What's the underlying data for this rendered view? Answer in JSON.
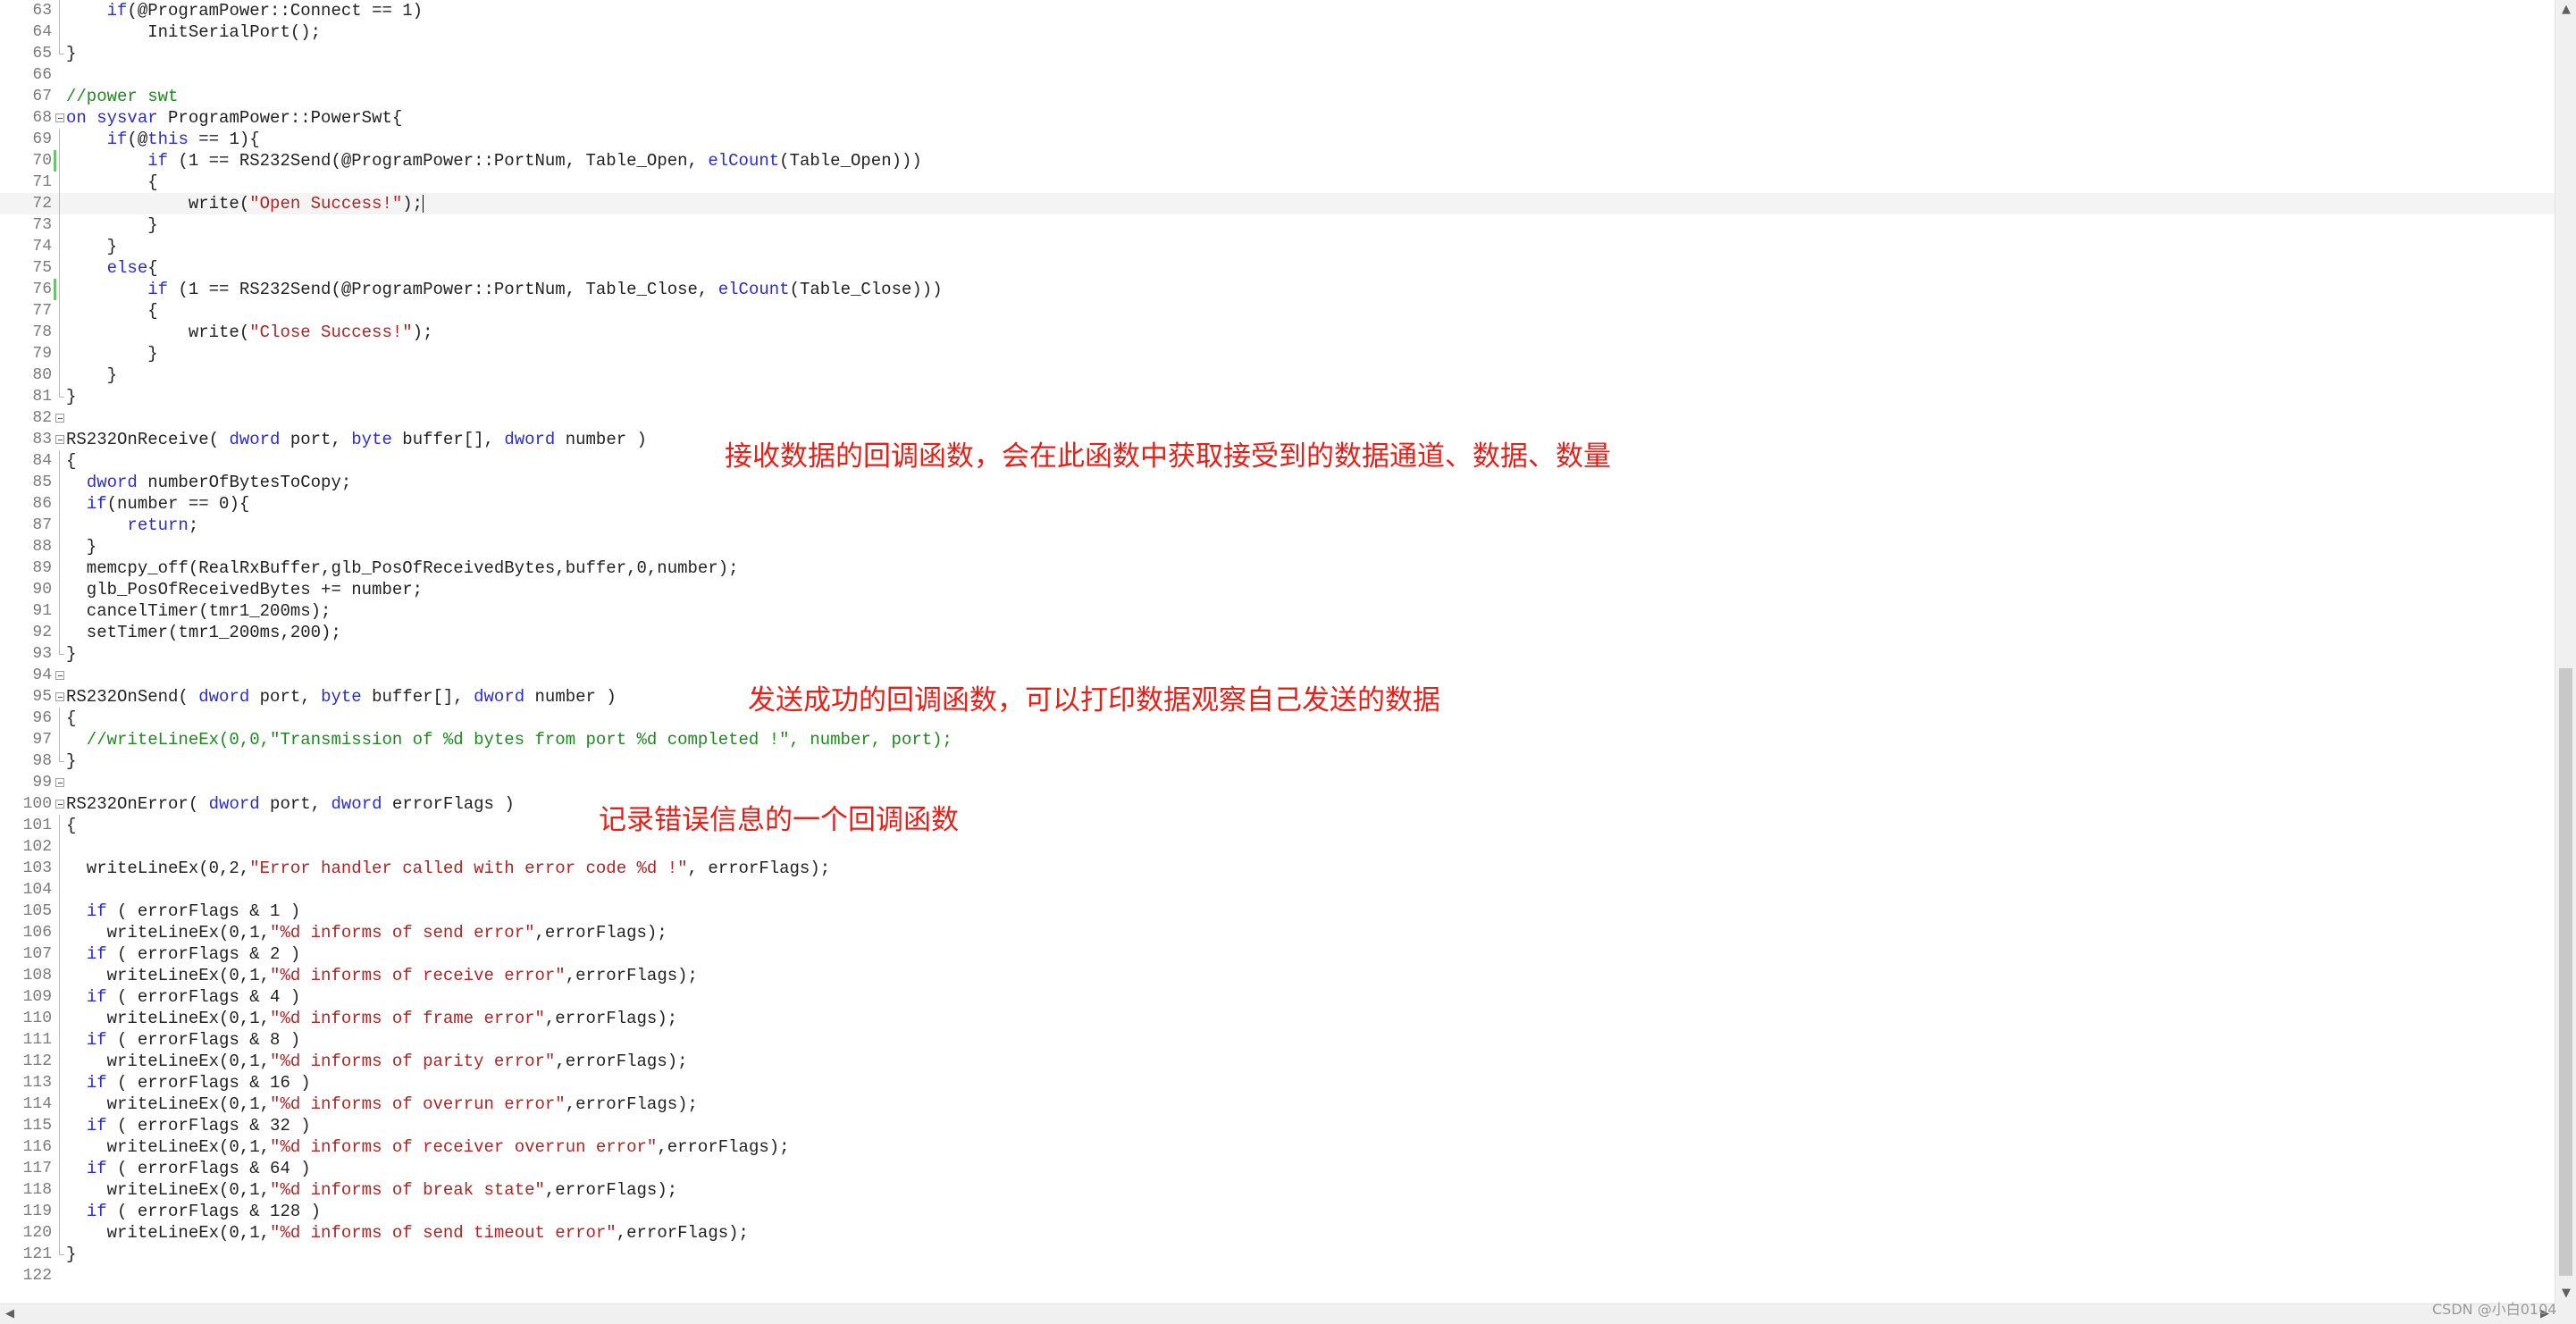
{
  "editor": {
    "lines": [
      {
        "n": "63",
        "fold": "line",
        "changed": false,
        "current": false,
        "tokens": [
          {
            "t": "    "
          },
          {
            "t": "if",
            "c": "kw"
          },
          {
            "t": "(@ProgramPower::Connect == 1)"
          }
        ]
      },
      {
        "n": "64",
        "fold": "line",
        "changed": false,
        "current": false,
        "tokens": [
          {
            "t": "        InitSerialPort();"
          }
        ]
      },
      {
        "n": "65",
        "fold": "end",
        "changed": false,
        "current": false,
        "tokens": [
          {
            "t": "}"
          }
        ]
      },
      {
        "n": "66",
        "fold": "",
        "changed": false,
        "current": false,
        "tokens": []
      },
      {
        "n": "67",
        "fold": "",
        "changed": false,
        "current": false,
        "tokens": [
          {
            "t": "//power swt",
            "c": "cm"
          }
        ]
      },
      {
        "n": "68",
        "fold": "start",
        "changed": false,
        "current": false,
        "tokens": [
          {
            "t": "on sysvar",
            "c": "kw"
          },
          {
            "t": " ProgramPower::PowerSwt{"
          }
        ]
      },
      {
        "n": "69",
        "fold": "line",
        "changed": false,
        "current": false,
        "tokens": [
          {
            "t": "    "
          },
          {
            "t": "if",
            "c": "kw"
          },
          {
            "t": "(@"
          },
          {
            "t": "this",
            "c": "kw"
          },
          {
            "t": " == 1){"
          }
        ]
      },
      {
        "n": "70",
        "fold": "line",
        "changed": true,
        "current": false,
        "tokens": [
          {
            "t": "        "
          },
          {
            "t": "if",
            "c": "kw"
          },
          {
            "t": " (1 == RS232Send(@ProgramPower::PortNum, Table_Open, "
          },
          {
            "t": "elCount",
            "c": "kw"
          },
          {
            "t": "(Table_Open)))"
          }
        ]
      },
      {
        "n": "71",
        "fold": "line",
        "changed": false,
        "current": false,
        "tokens": [
          {
            "t": "        {"
          }
        ]
      },
      {
        "n": "72",
        "fold": "line",
        "changed": false,
        "current": true,
        "caret": true,
        "tokens": [
          {
            "t": "            write("
          },
          {
            "t": "\"Open Success!\"",
            "c": "str"
          },
          {
            "t": ");"
          }
        ]
      },
      {
        "n": "73",
        "fold": "line",
        "changed": false,
        "current": false,
        "tokens": [
          {
            "t": "        }"
          }
        ]
      },
      {
        "n": "74",
        "fold": "line",
        "changed": false,
        "current": false,
        "tokens": [
          {
            "t": "    }"
          }
        ]
      },
      {
        "n": "75",
        "fold": "line",
        "changed": false,
        "current": false,
        "tokens": [
          {
            "t": "    "
          },
          {
            "t": "else",
            "c": "kw"
          },
          {
            "t": "{"
          }
        ]
      },
      {
        "n": "76",
        "fold": "line",
        "changed": true,
        "current": false,
        "tokens": [
          {
            "t": "        "
          },
          {
            "t": "if",
            "c": "kw"
          },
          {
            "t": " (1 == RS232Send(@ProgramPower::PortNum, Table_Close, "
          },
          {
            "t": "elCount",
            "c": "kw"
          },
          {
            "t": "(Table_Close)))"
          }
        ]
      },
      {
        "n": "77",
        "fold": "line",
        "changed": false,
        "current": false,
        "tokens": [
          {
            "t": "        {"
          }
        ]
      },
      {
        "n": "78",
        "fold": "line",
        "changed": false,
        "current": false,
        "tokens": [
          {
            "t": "            write("
          },
          {
            "t": "\"Close Success!\"",
            "c": "str"
          },
          {
            "t": ");"
          }
        ]
      },
      {
        "n": "79",
        "fold": "line",
        "changed": false,
        "current": false,
        "tokens": [
          {
            "t": "        }"
          }
        ]
      },
      {
        "n": "80",
        "fold": "line",
        "changed": false,
        "current": false,
        "tokens": [
          {
            "t": "    }"
          }
        ]
      },
      {
        "n": "81",
        "fold": "end",
        "changed": false,
        "current": false,
        "tokens": [
          {
            "t": "}"
          }
        ]
      },
      {
        "n": "82",
        "fold": "start",
        "changed": false,
        "current": false,
        "tokens": []
      },
      {
        "n": "83",
        "fold": "start",
        "changed": false,
        "current": false,
        "tokens": [
          {
            "t": "RS232OnReceive( "
          },
          {
            "t": "dword",
            "c": "kw"
          },
          {
            "t": " port, "
          },
          {
            "t": "byte",
            "c": "kw"
          },
          {
            "t": " buffer[], "
          },
          {
            "t": "dword",
            "c": "kw"
          },
          {
            "t": " number )"
          }
        ]
      },
      {
        "n": "84",
        "fold": "line",
        "changed": false,
        "current": false,
        "tokens": [
          {
            "t": "{"
          }
        ]
      },
      {
        "n": "85",
        "fold": "line",
        "changed": false,
        "current": false,
        "tokens": [
          {
            "t": "  "
          },
          {
            "t": "dword",
            "c": "kw"
          },
          {
            "t": " numberOfBytesToCopy;"
          }
        ]
      },
      {
        "n": "86",
        "fold": "line",
        "changed": false,
        "current": false,
        "tokens": [
          {
            "t": "  "
          },
          {
            "t": "if",
            "c": "kw"
          },
          {
            "t": "(number == 0){"
          }
        ]
      },
      {
        "n": "87",
        "fold": "line",
        "changed": false,
        "current": false,
        "tokens": [
          {
            "t": "      "
          },
          {
            "t": "return",
            "c": "kw"
          },
          {
            "t": ";"
          }
        ]
      },
      {
        "n": "88",
        "fold": "line",
        "changed": false,
        "current": false,
        "tokens": [
          {
            "t": "  }"
          }
        ]
      },
      {
        "n": "89",
        "fold": "line",
        "changed": false,
        "current": false,
        "tokens": [
          {
            "t": "  memcpy_off(RealRxBuffer,glb_PosOfReceivedBytes,buffer,0,number);"
          }
        ]
      },
      {
        "n": "90",
        "fold": "line",
        "changed": false,
        "current": false,
        "tokens": [
          {
            "t": "  glb_PosOfReceivedBytes += number;"
          }
        ]
      },
      {
        "n": "91",
        "fold": "line",
        "changed": false,
        "current": false,
        "tokens": [
          {
            "t": "  cancelTimer(tmr1_200ms);"
          }
        ]
      },
      {
        "n": "92",
        "fold": "line",
        "changed": false,
        "current": false,
        "tokens": [
          {
            "t": "  setTimer(tmr1_200ms,200);"
          }
        ]
      },
      {
        "n": "93",
        "fold": "end",
        "changed": false,
        "current": false,
        "tokens": [
          {
            "t": "}"
          }
        ]
      },
      {
        "n": "94",
        "fold": "start",
        "changed": false,
        "current": false,
        "tokens": []
      },
      {
        "n": "95",
        "fold": "start",
        "changed": false,
        "current": false,
        "tokens": [
          {
            "t": "RS232OnSend( "
          },
          {
            "t": "dword",
            "c": "kw"
          },
          {
            "t": " port, "
          },
          {
            "t": "byte",
            "c": "kw"
          },
          {
            "t": " buffer[], "
          },
          {
            "t": "dword",
            "c": "kw"
          },
          {
            "t": " number )"
          }
        ]
      },
      {
        "n": "96",
        "fold": "line",
        "changed": false,
        "current": false,
        "tokens": [
          {
            "t": "{"
          }
        ]
      },
      {
        "n": "97",
        "fold": "line",
        "changed": false,
        "current": false,
        "tokens": [
          {
            "t": "  //writeLineEx(0,0,\"Transmission of %d bytes from port %d completed !\", number, port);",
            "c": "cm"
          }
        ]
      },
      {
        "n": "98",
        "fold": "end",
        "changed": false,
        "current": false,
        "tokens": [
          {
            "t": "}"
          }
        ]
      },
      {
        "n": "99",
        "fold": "start",
        "changed": false,
        "current": false,
        "tokens": []
      },
      {
        "n": "100",
        "fold": "start",
        "changed": false,
        "current": false,
        "tokens": [
          {
            "t": "RS232OnError( "
          },
          {
            "t": "dword",
            "c": "kw"
          },
          {
            "t": " port, "
          },
          {
            "t": "dword",
            "c": "kw"
          },
          {
            "t": " errorFlags )"
          }
        ]
      },
      {
        "n": "101",
        "fold": "line",
        "changed": false,
        "current": false,
        "tokens": [
          {
            "t": "{"
          }
        ]
      },
      {
        "n": "102",
        "fold": "line",
        "changed": false,
        "current": false,
        "tokens": []
      },
      {
        "n": "103",
        "fold": "line",
        "changed": false,
        "current": false,
        "tokens": [
          {
            "t": "  writeLineEx(0,2,"
          },
          {
            "t": "\"Error handler called with error code %d !\"",
            "c": "str"
          },
          {
            "t": ", errorFlags);"
          }
        ]
      },
      {
        "n": "104",
        "fold": "line",
        "changed": false,
        "current": false,
        "tokens": []
      },
      {
        "n": "105",
        "fold": "line",
        "changed": false,
        "current": false,
        "tokens": [
          {
            "t": "  "
          },
          {
            "t": "if",
            "c": "kw"
          },
          {
            "t": " ( errorFlags & 1 )"
          }
        ]
      },
      {
        "n": "106",
        "fold": "line",
        "changed": false,
        "current": false,
        "tokens": [
          {
            "t": "    writeLineEx(0,1,"
          },
          {
            "t": "\"%d informs of send error\"",
            "c": "str"
          },
          {
            "t": ",errorFlags);"
          }
        ]
      },
      {
        "n": "107",
        "fold": "line",
        "changed": false,
        "current": false,
        "tokens": [
          {
            "t": "  "
          },
          {
            "t": "if",
            "c": "kw"
          },
          {
            "t": " ( errorFlags & 2 )"
          }
        ]
      },
      {
        "n": "108",
        "fold": "line",
        "changed": false,
        "current": false,
        "tokens": [
          {
            "t": "    writeLineEx(0,1,"
          },
          {
            "t": "\"%d informs of receive error\"",
            "c": "str"
          },
          {
            "t": ",errorFlags);"
          }
        ]
      },
      {
        "n": "109",
        "fold": "line",
        "changed": false,
        "current": false,
        "tokens": [
          {
            "t": "  "
          },
          {
            "t": "if",
            "c": "kw"
          },
          {
            "t": " ( errorFlags & 4 )"
          }
        ]
      },
      {
        "n": "110",
        "fold": "line",
        "changed": false,
        "current": false,
        "tokens": [
          {
            "t": "    writeLineEx(0,1,"
          },
          {
            "t": "\"%d informs of frame error\"",
            "c": "str"
          },
          {
            "t": ",errorFlags);"
          }
        ]
      },
      {
        "n": "111",
        "fold": "line",
        "changed": false,
        "current": false,
        "tokens": [
          {
            "t": "  "
          },
          {
            "t": "if",
            "c": "kw"
          },
          {
            "t": " ( errorFlags & 8 )"
          }
        ]
      },
      {
        "n": "112",
        "fold": "line",
        "changed": false,
        "current": false,
        "tokens": [
          {
            "t": "    writeLineEx(0,1,"
          },
          {
            "t": "\"%d informs of parity error\"",
            "c": "str"
          },
          {
            "t": ",errorFlags);"
          }
        ]
      },
      {
        "n": "113",
        "fold": "line",
        "changed": false,
        "current": false,
        "tokens": [
          {
            "t": "  "
          },
          {
            "t": "if",
            "c": "kw"
          },
          {
            "t": " ( errorFlags & 16 )"
          }
        ]
      },
      {
        "n": "114",
        "fold": "line",
        "changed": false,
        "current": false,
        "tokens": [
          {
            "t": "    writeLineEx(0,1,"
          },
          {
            "t": "\"%d informs of overrun error\"",
            "c": "str"
          },
          {
            "t": ",errorFlags);"
          }
        ]
      },
      {
        "n": "115",
        "fold": "line",
        "changed": false,
        "current": false,
        "tokens": [
          {
            "t": "  "
          },
          {
            "t": "if",
            "c": "kw"
          },
          {
            "t": " ( errorFlags & 32 )"
          }
        ]
      },
      {
        "n": "116",
        "fold": "line",
        "changed": false,
        "current": false,
        "tokens": [
          {
            "t": "    writeLineEx(0,1,"
          },
          {
            "t": "\"%d informs of receiver overrun error\"",
            "c": "str"
          },
          {
            "t": ",errorFlags);"
          }
        ]
      },
      {
        "n": "117",
        "fold": "line",
        "changed": false,
        "current": false,
        "tokens": [
          {
            "t": "  "
          },
          {
            "t": "if",
            "c": "kw"
          },
          {
            "t": " ( errorFlags & 64 )"
          }
        ]
      },
      {
        "n": "118",
        "fold": "line",
        "changed": false,
        "current": false,
        "tokens": [
          {
            "t": "    writeLineEx(0,1,"
          },
          {
            "t": "\"%d informs of break state\"",
            "c": "str"
          },
          {
            "t": ",errorFlags);"
          }
        ]
      },
      {
        "n": "119",
        "fold": "line",
        "changed": false,
        "current": false,
        "tokens": [
          {
            "t": "  "
          },
          {
            "t": "if",
            "c": "kw"
          },
          {
            "t": " ( errorFlags & 128 )"
          }
        ]
      },
      {
        "n": "120",
        "fold": "line",
        "changed": false,
        "current": false,
        "tokens": [
          {
            "t": "    writeLineEx(0,1,"
          },
          {
            "t": "\"%d informs of send timeout error\"",
            "c": "str"
          },
          {
            "t": ",errorFlags);"
          }
        ]
      },
      {
        "n": "121",
        "fold": "end",
        "changed": false,
        "current": false,
        "tokens": [
          {
            "t": "}"
          }
        ]
      },
      {
        "n": "122",
        "fold": "",
        "changed": false,
        "current": false,
        "tokens": []
      }
    ]
  },
  "annotations": {
    "receive": "接收数据的回调函数，会在此函数中获取接受到的数据通道、数据、数量",
    "send": "发送成功的回调函数，可以打印数据观察自己发送的数据",
    "error": "记录错误信息的一个回调函数"
  },
  "watermark": "CSDN @小白0104",
  "scrollbar": {
    "up_icon": "chevron-up-icon",
    "down_icon": "chevron-down-icon",
    "left_icon": "chevron-left-icon",
    "right_icon": "chevron-right-icon"
  },
  "colors": {
    "keyword": "#2a2ad6",
    "string": "#b22222",
    "comment": "#1e8a1e",
    "annotation": "#e32119",
    "change_marker": "#6cc46c"
  }
}
